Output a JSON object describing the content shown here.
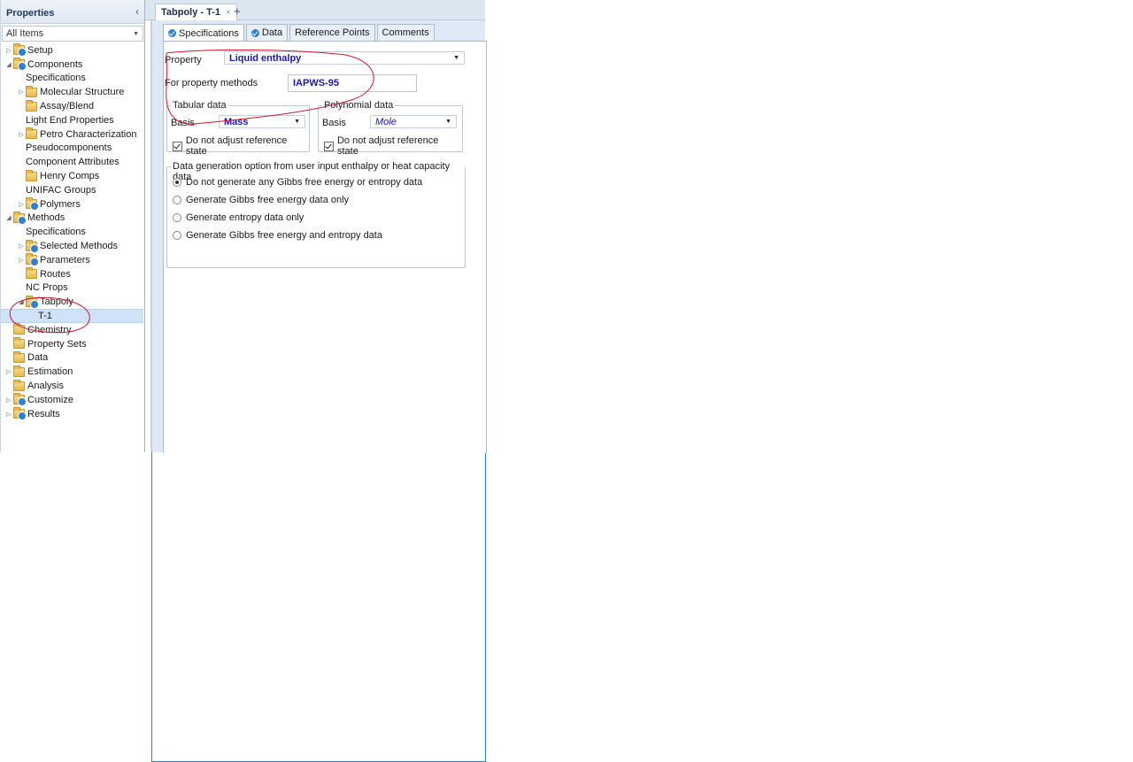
{
  "nav": {
    "title": "Properties",
    "filter": "All Items",
    "items": [
      {
        "label": "Setup",
        "level": 0,
        "expander": "▷",
        "icon": "folder-check"
      },
      {
        "label": "Components",
        "level": 0,
        "expander": "◢",
        "icon": "folder-check"
      },
      {
        "label": "Specifications",
        "level": 1,
        "expander": "",
        "icon": "form"
      },
      {
        "label": "Molecular Structure",
        "level": 1,
        "expander": "▷",
        "icon": "folder"
      },
      {
        "label": "Assay/Blend",
        "level": 1,
        "expander": "",
        "icon": "folder"
      },
      {
        "label": "Light End Properties",
        "level": 1,
        "expander": "",
        "icon": "form"
      },
      {
        "label": "Petro Characterization",
        "level": 1,
        "expander": "▷",
        "icon": "folder"
      },
      {
        "label": "Pseudocomponents",
        "level": 1,
        "expander": "",
        "icon": "form-plain"
      },
      {
        "label": "Component Attributes",
        "level": 1,
        "expander": "",
        "icon": "form"
      },
      {
        "label": "Henry Comps",
        "level": 1,
        "expander": "",
        "icon": "folder"
      },
      {
        "label": "UNIFAC Groups",
        "level": 1,
        "expander": "",
        "icon": "form"
      },
      {
        "label": "Polymers",
        "level": 1,
        "expander": "▷",
        "icon": "folder-check"
      },
      {
        "label": "Methods",
        "level": 0,
        "expander": "◢",
        "icon": "folder-check"
      },
      {
        "label": "Specifications",
        "level": 1,
        "expander": "",
        "icon": "form"
      },
      {
        "label": "Selected Methods",
        "level": 1,
        "expander": "▷",
        "icon": "folder-check"
      },
      {
        "label": "Parameters",
        "level": 1,
        "expander": "▷",
        "icon": "folder-check"
      },
      {
        "label": "Routes",
        "level": 1,
        "expander": "",
        "icon": "folder"
      },
      {
        "label": "NC Props",
        "level": 1,
        "expander": "",
        "icon": "form"
      },
      {
        "label": "Tabpoly",
        "level": 1,
        "expander": "◢",
        "icon": "folder-check"
      },
      {
        "label": "T-1",
        "level": 2,
        "expander": "",
        "icon": "form",
        "selected": true
      },
      {
        "label": "Chemistry",
        "level": 0,
        "expander": "",
        "icon": "folder"
      },
      {
        "label": "Property Sets",
        "level": 0,
        "expander": "",
        "icon": "folder"
      },
      {
        "label": "Data",
        "level": 0,
        "expander": "",
        "icon": "folder"
      },
      {
        "label": "Estimation",
        "level": 0,
        "expander": "▷",
        "icon": "folder"
      },
      {
        "label": "Analysis",
        "level": 0,
        "expander": "",
        "icon": "folder"
      },
      {
        "label": "Customize",
        "level": 0,
        "expander": "▷",
        "icon": "folder-check"
      },
      {
        "label": "Results",
        "level": 0,
        "expander": "▷",
        "icon": "folder-check"
      }
    ]
  },
  "doc_tab": {
    "label": "Tabpoly - T-1",
    "close": "×",
    "add": "+"
  },
  "subtabs": [
    {
      "label": "Specifications",
      "check": true,
      "active": true
    },
    {
      "label": "Data",
      "check": true,
      "active": false
    },
    {
      "label": "Reference Points",
      "check": false,
      "active": false
    },
    {
      "label": "Comments",
      "check": false,
      "active": false
    }
  ],
  "form": {
    "property_label": "Property",
    "property_value": "Liquid enthalpy",
    "methods_label": "For property methods",
    "methods_value": "IAPWS-95",
    "tabular": {
      "title": "Tabular data",
      "basis_label": "Basis",
      "basis_value": "Mass",
      "checkbox_label": "Do not adjust reference state",
      "checked": true
    },
    "polynomial": {
      "title": "Polynomial data",
      "basis_label": "Basis",
      "basis_value": "Mole",
      "checkbox_label": "Do not adjust reference state",
      "checked": true
    },
    "generation": {
      "title": "Data generation option from user input enthalpy or heat capacity data",
      "options": [
        {
          "label": "Do not generate any Gibbs free energy or entropy data",
          "selected": true
        },
        {
          "label": "Generate Gibbs free energy data only",
          "selected": false
        },
        {
          "label": "Generate entropy data only",
          "selected": false
        },
        {
          "label": "Generate Gibbs free energy and entropy data",
          "selected": false
        }
      ]
    }
  },
  "colors": {
    "annotation": "#d0162b",
    "accent": "#2f7fd6",
    "value_text": "#1a1ab0"
  }
}
